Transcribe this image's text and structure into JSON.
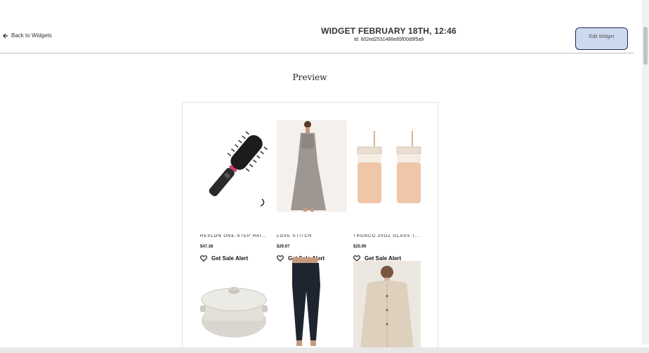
{
  "header": {
    "back_label": "Back to Widgets",
    "title": "WIDGET FEBRUARY 18TH, 12:46",
    "id_text": "Id: 602ed2531486e85f00d9f5a9",
    "edit_label": "Edit Widget",
    "edit_bg": "#cdd9ee",
    "edit_border": "#1f2d4d"
  },
  "preview": {
    "title": "Preview",
    "alert_label": "Get Sale Alert",
    "products": [
      {
        "name": "REVLON ONE-STEP HAI...",
        "price": "$47.38",
        "image": "hair-dryer-brush-image"
      },
      {
        "name": "LOVE STITCH",
        "price": "$29.97",
        "image": "maxi-dress-image"
      },
      {
        "name": "TRONCO 20OZ GLASS T...",
        "price": "$25.99",
        "image": "glass-tumbler-image"
      },
      {
        "name": "",
        "price": "",
        "image": "dutch-oven-image"
      },
      {
        "name": "",
        "price": "",
        "image": "leggings-image"
      },
      {
        "name": "",
        "price": "",
        "image": "sherpa-jacket-image"
      }
    ]
  }
}
